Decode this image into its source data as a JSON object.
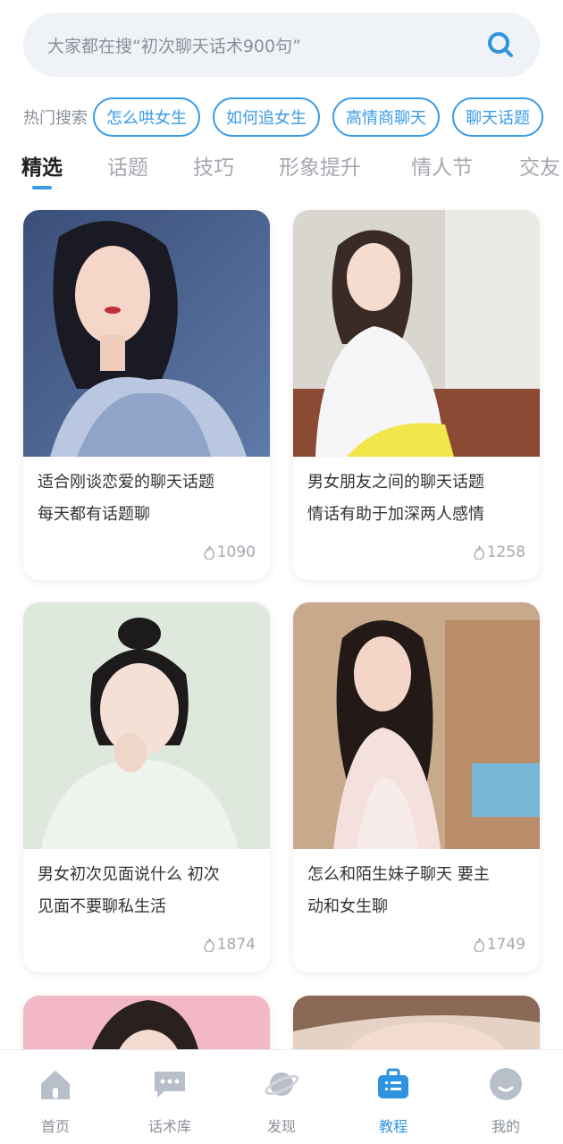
{
  "search": {
    "placeholder": "大家都在搜“初次聊天话术900句”"
  },
  "hot_search": {
    "label": "热门搜索",
    "tags": [
      "怎么哄女生",
      "如何追女生",
      "高情商聊天",
      "聊天话题"
    ]
  },
  "tabs": [
    "精选",
    "话题",
    "技巧",
    "形象提升",
    "情人节",
    "交友"
  ],
  "active_tab": "精选",
  "cards": [
    {
      "line1": "适合刚谈恋爱的聊天话题",
      "line2": "每天都有话题聊",
      "views": "1090"
    },
    {
      "line1": "男女朋友之间的聊天话题",
      "line2": "情话有助于加深两人感情",
      "views": "1258"
    },
    {
      "line1": "男女初次见面说什么 初次",
      "line2": "见面不要聊私生活",
      "views": "1874"
    },
    {
      "line1": "怎么和陌生妹子聊天 要主",
      "line2": "动和女生聊",
      "views": "1749"
    }
  ],
  "bottom_nav": [
    {
      "label": "首页",
      "icon": "home-icon"
    },
    {
      "label": "话术库",
      "icon": "chat-bubble-icon"
    },
    {
      "label": "发现",
      "icon": "planet-icon"
    },
    {
      "label": "教程",
      "icon": "tutorial-bag-icon"
    },
    {
      "label": "我的",
      "icon": "profile-icon"
    }
  ],
  "active_nav": "教程",
  "colors": {
    "accent": "#3a9be6",
    "inactive": "#a4a8b0",
    "search_bg": "#eff2f7"
  }
}
